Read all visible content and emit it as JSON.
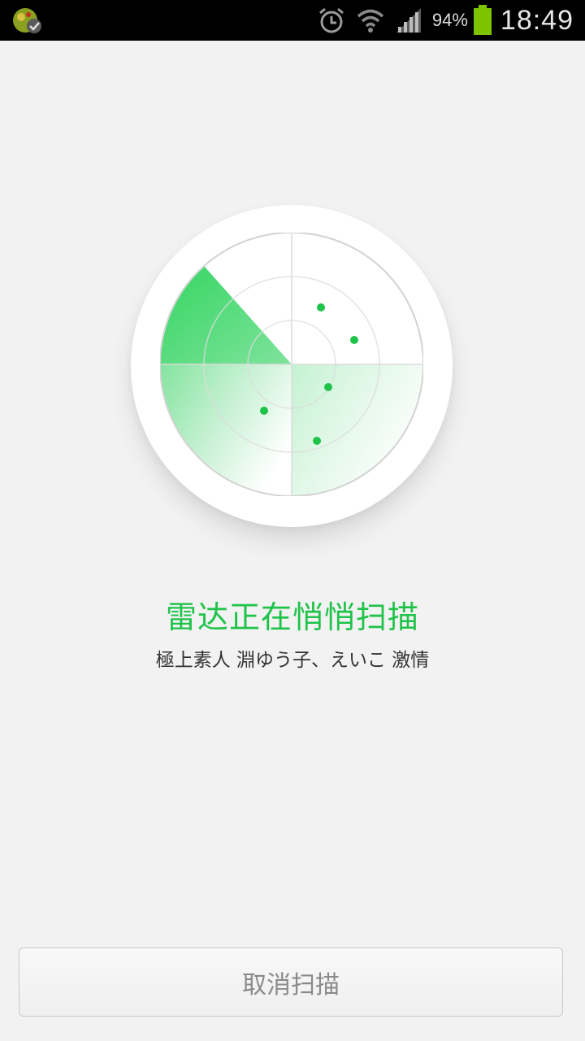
{
  "status_bar": {
    "battery_percent": "94%",
    "time": "18:49",
    "icons": [
      "app-notification-icon",
      "alarm-icon",
      "wifi-icon",
      "signal-icon",
      "battery-icon"
    ]
  },
  "radar": {
    "state": "scanning",
    "dot_count": 5
  },
  "main": {
    "title": "雷达正在悄悄扫描",
    "subtitle": "極上素人 淵ゆう子、えいこ 激情"
  },
  "buttons": {
    "cancel_label": "取消扫描"
  },
  "colors": {
    "accent": "#1fc34a",
    "background": "#f2f2f2",
    "status_bar": "#000000"
  }
}
